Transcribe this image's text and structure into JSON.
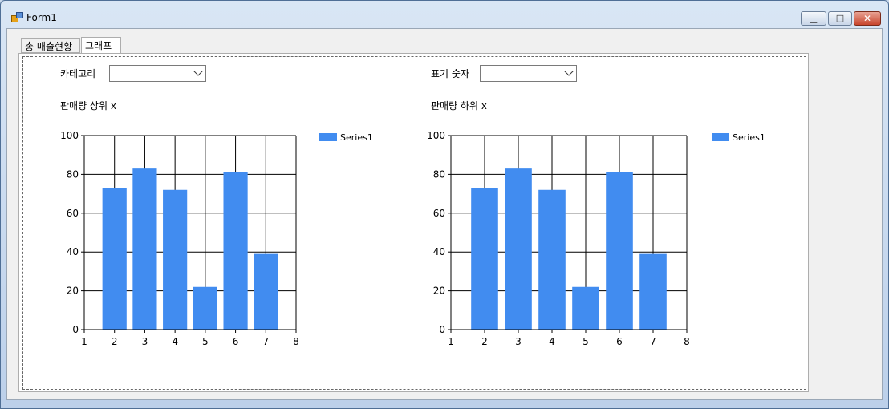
{
  "window": {
    "title": "Form1",
    "minimize_icon": "minimize-icon",
    "maximize_icon": "maximize-icon",
    "close_icon": "close-icon"
  },
  "tabs": [
    {
      "label": "총 매출현황"
    },
    {
      "label": "그래프"
    }
  ],
  "left_panel": {
    "category_label": "카테고리",
    "category_value": "",
    "chart_label": "판매량 상위 x"
  },
  "right_panel": {
    "display_count_label": "표기 숫자",
    "display_count_value": "",
    "chart_label": "판매량 하위 x"
  },
  "chart_data": [
    {
      "type": "bar",
      "x": [
        2,
        3,
        4,
        5,
        6,
        7
      ],
      "series": [
        {
          "name": "Series1",
          "values": [
            73,
            83,
            72,
            22,
            81,
            39
          ],
          "color": "#418cf0"
        }
      ],
      "xlim": [
        1,
        8
      ],
      "ylim": [
        0,
        100
      ],
      "x_ticks": [
        "1",
        "2",
        "3",
        "4",
        "5",
        "6",
        "7",
        "8"
      ],
      "y_ticks": [
        "0",
        "20",
        "40",
        "60",
        "80",
        "100"
      ],
      "grid": true,
      "legend": "top-right"
    },
    {
      "type": "bar",
      "x": [
        2,
        3,
        4,
        5,
        6,
        7
      ],
      "series": [
        {
          "name": "Series1",
          "values": [
            73,
            83,
            72,
            22,
            81,
            39
          ],
          "color": "#418cf0"
        }
      ],
      "xlim": [
        1,
        8
      ],
      "ylim": [
        0,
        100
      ],
      "x_ticks": [
        "1",
        "2",
        "3",
        "4",
        "5",
        "6",
        "7",
        "8"
      ],
      "y_ticks": [
        "0",
        "20",
        "40",
        "60",
        "80",
        "100"
      ],
      "grid": true,
      "legend": "top-right"
    }
  ]
}
